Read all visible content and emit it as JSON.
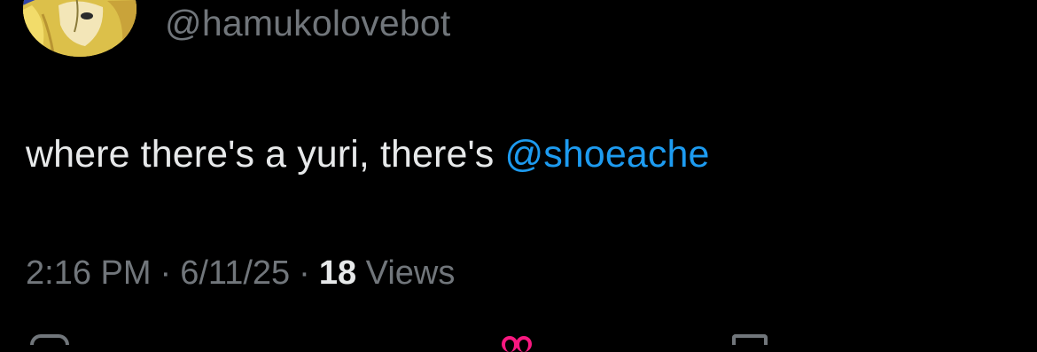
{
  "tweet": {
    "handle": "@hamukolovebot",
    "text": "where there's a yuri, there's ",
    "mention": "@shoeache",
    "time": "2:16 PM",
    "date": "6/11/25",
    "view_count": "18",
    "view_label": "Views"
  },
  "icons": {
    "avatar": "avatar-image",
    "reply": "reply-icon",
    "like": "heart-icon",
    "bookmark": "bookmark-icon"
  },
  "colors": {
    "background": "#000000",
    "text": "#e7e9ea",
    "secondary": "#71767b",
    "mention": "#1d9bf0",
    "like": "#f91880"
  }
}
